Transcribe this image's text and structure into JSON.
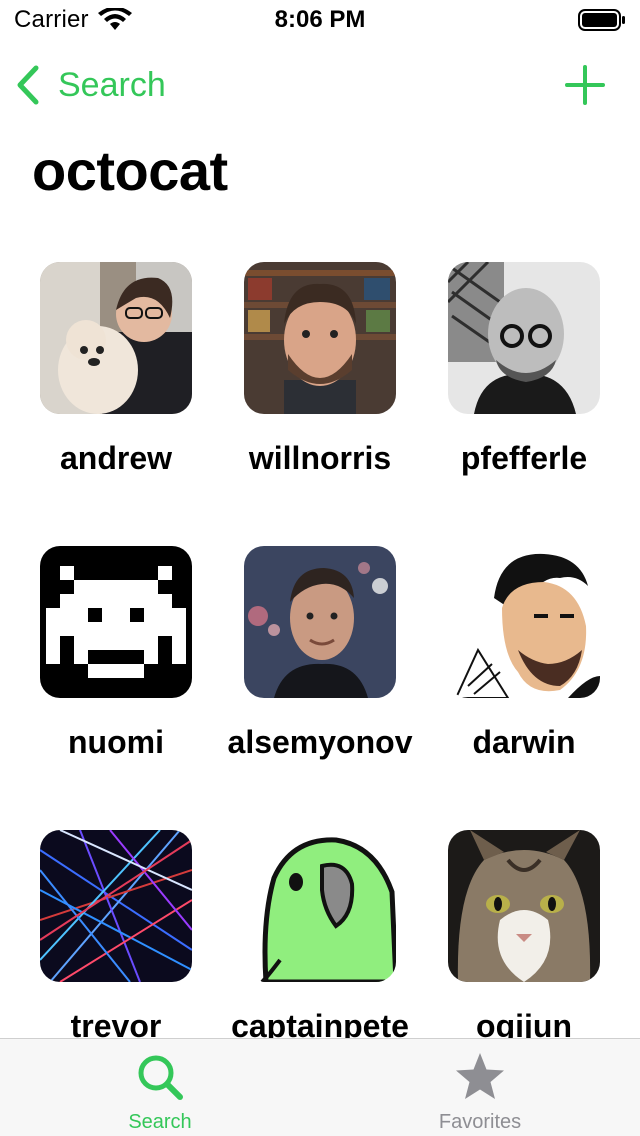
{
  "status_bar": {
    "carrier": "Carrier",
    "time": "8:06 PM"
  },
  "nav": {
    "back_label": "Search",
    "add_icon": "plus-icon"
  },
  "page": {
    "title": "octocat"
  },
  "users": [
    {
      "username": "andrew"
    },
    {
      "username": "willnorris"
    },
    {
      "username": "pfefferle"
    },
    {
      "username": "nuomi"
    },
    {
      "username": "alsemyonov"
    },
    {
      "username": "darwin"
    },
    {
      "username": "trevor"
    },
    {
      "username": "captainpete"
    },
    {
      "username": "ogijun"
    }
  ],
  "tab_bar": {
    "tabs": [
      {
        "label": "Search",
        "icon": "search-icon",
        "active": true
      },
      {
        "label": "Favorites",
        "icon": "star-icon",
        "active": false
      }
    ]
  },
  "colors": {
    "accent": "#34c759",
    "inactive": "#8e8e93"
  }
}
